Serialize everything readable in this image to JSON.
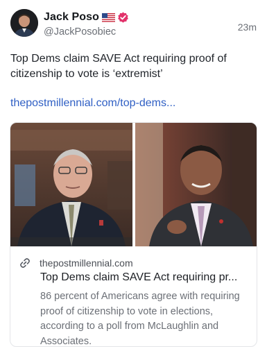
{
  "author": {
    "display_name": "Jack Poso",
    "flag_emoji": "🇺🇸",
    "handle": "@JackPosobiec",
    "verified_badge": "verified-badge-icon"
  },
  "post": {
    "timestamp": "23m",
    "text": "Top Dems claim SAVE Act requiring proof of citizenship to vote is ‘extremist’",
    "link_text": "thepostmillennial.com/top-dems..."
  },
  "card": {
    "domain": "thepostmillennial.com",
    "title": "Top Dems claim SAVE Act requiring pr...",
    "description": "86 percent of Americans agree with requiring proof of citizenship to vote in elections, according to a poll from McLaughlin and Associates."
  },
  "colors": {
    "link": "#2f5fc4",
    "badge": "#e2336b",
    "secondary_text": "#6b6f76"
  }
}
